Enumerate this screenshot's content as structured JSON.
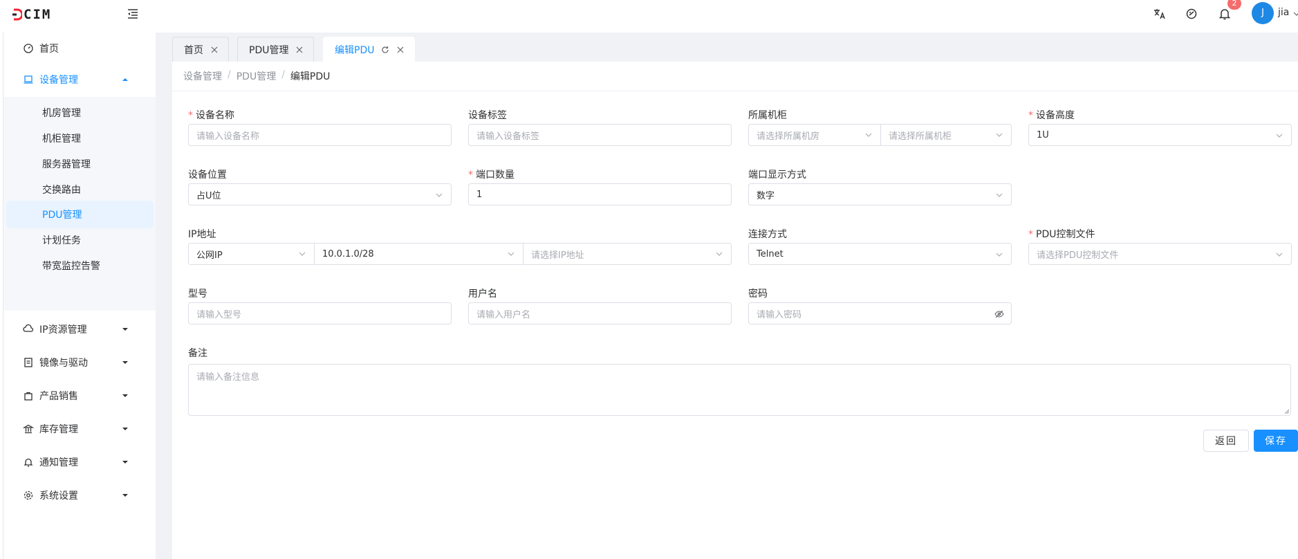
{
  "header": {
    "logo_text": "CIM",
    "language_icon": "translate-icon",
    "theme_icon": "palette-icon",
    "notification_icon": "bell-icon",
    "notification_count": "2",
    "avatar_initial": "J",
    "username": "jia"
  },
  "sidebar": {
    "items": [
      {
        "label": "首页",
        "icon": "dashboard-icon"
      },
      {
        "label": "设备管理",
        "icon": "laptop-icon"
      },
      {
        "label": "IP资源管理",
        "icon": "cloud-icon"
      },
      {
        "label": "镜像与驱动",
        "icon": "file-icon"
      },
      {
        "label": "产品销售",
        "icon": "bag-icon"
      },
      {
        "label": "库存管理",
        "icon": "bank-icon"
      },
      {
        "label": "通知管理",
        "icon": "bell-icon"
      },
      {
        "label": "系统设置",
        "icon": "gear-icon"
      }
    ],
    "sub_items": [
      {
        "label": "机房管理"
      },
      {
        "label": "机柜管理"
      },
      {
        "label": "服务器管理"
      },
      {
        "label": "交换路由"
      },
      {
        "label": "PDU管理"
      },
      {
        "label": "计划任务"
      },
      {
        "label": "带宽监控告警"
      }
    ]
  },
  "tabs": [
    {
      "label": "首页"
    },
    {
      "label": "PDU管理"
    },
    {
      "label": "编辑PDU"
    }
  ],
  "breadcrumb": {
    "items": [
      "设备管理",
      "PDU管理",
      "编辑PDU"
    ],
    "separator": "/"
  },
  "form": {
    "required_mark": "*",
    "device_name": {
      "label": "设备名称",
      "placeholder": "请输入设备名称",
      "value": ""
    },
    "device_tag": {
      "label": "设备标签",
      "placeholder": "请输入设备标签",
      "value": ""
    },
    "cabinet": {
      "label": "所属机柜",
      "room_placeholder": "请选择所属机房",
      "cabinet_placeholder": "请选择所属机柜"
    },
    "device_height": {
      "label": "设备高度",
      "value": "1U"
    },
    "device_position": {
      "label": "设备位置",
      "value": "占U位"
    },
    "port_count": {
      "label": "端口数量",
      "value": "1"
    },
    "port_display": {
      "label": "端口显示方式",
      "value": "数字"
    },
    "ip": {
      "label": "IP地址",
      "type_value": "公网IP",
      "subnet_value": "10.0.1.0/28",
      "address_placeholder": "请选择IP地址"
    },
    "connection": {
      "label": "连接方式",
      "value": "Telnet"
    },
    "control_file": {
      "label": "PDU控制文件",
      "placeholder": "请选择PDU控制文件"
    },
    "model": {
      "label": "型号",
      "placeholder": "请输入型号"
    },
    "username": {
      "label": "用户名",
      "placeholder": "请输入用户名"
    },
    "password": {
      "label": "密码",
      "placeholder": "请输入密码"
    },
    "remark": {
      "label": "备注",
      "placeholder": "请输入备注信息"
    }
  },
  "actions": {
    "back_label": "返回",
    "save_label": "保存"
  },
  "colors": {
    "primary": "#1890ff",
    "danger": "#f56c6c",
    "logo_accent": "#f5222d"
  }
}
